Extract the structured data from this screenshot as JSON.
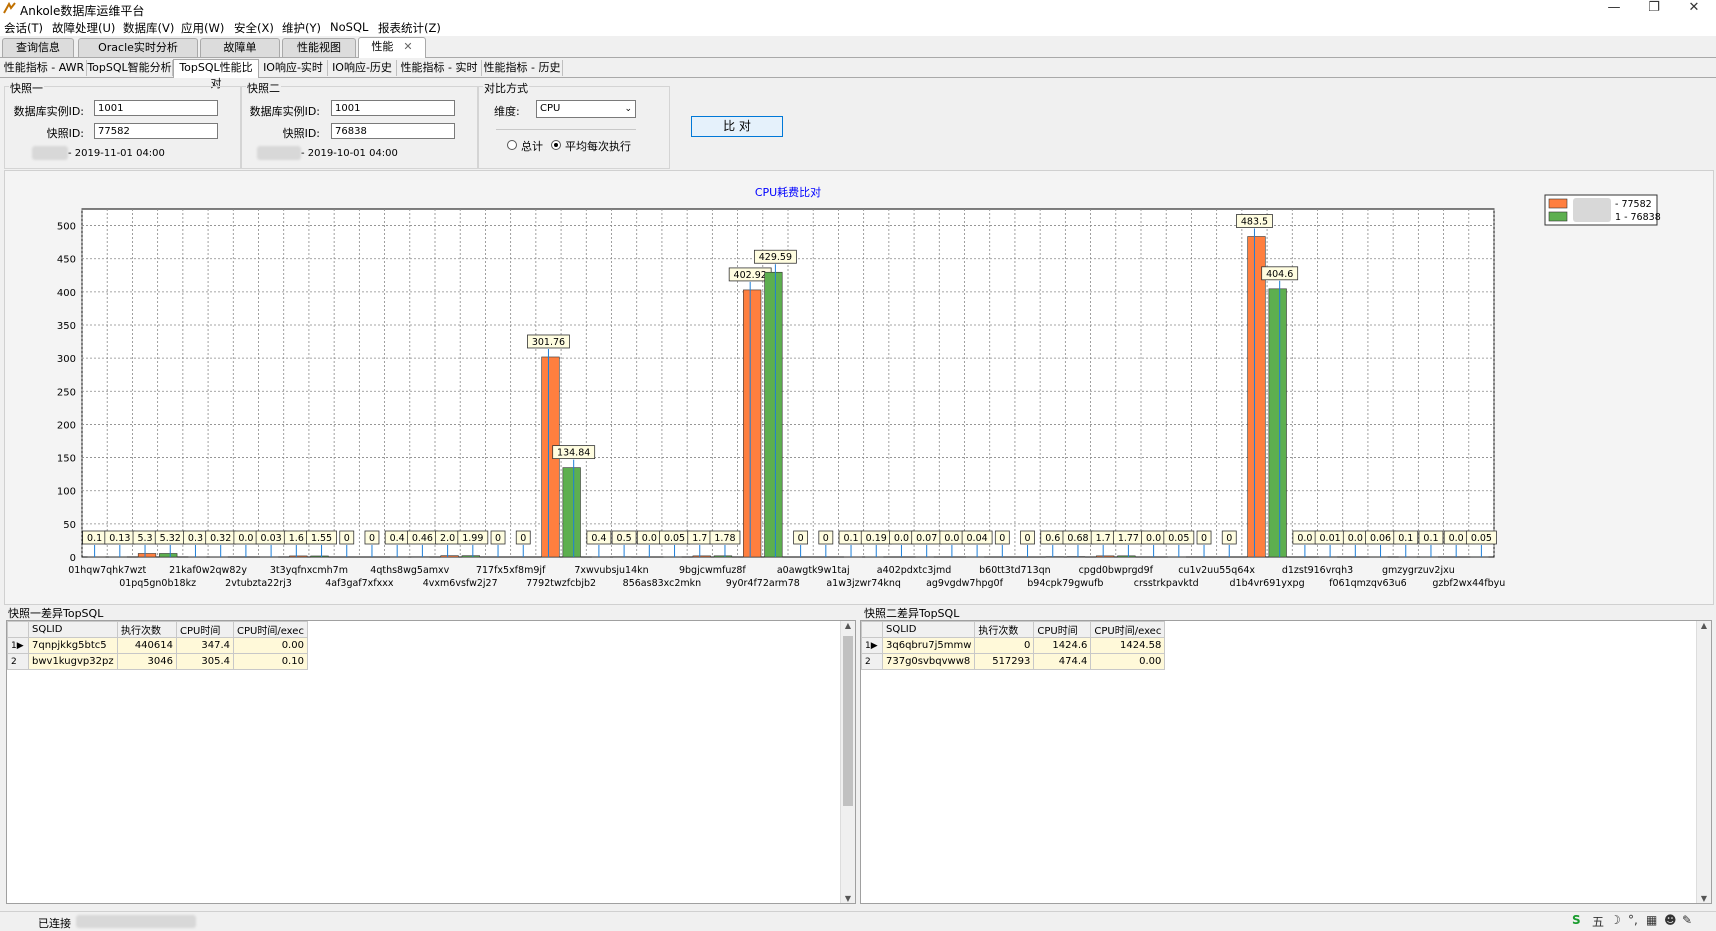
{
  "window": {
    "title": "Ankole数据库运维平台",
    "min": "—",
    "max": "❐",
    "close": "✕"
  },
  "menu": [
    "会话(T)",
    "故障处理(U)",
    "数据库(V)",
    "应用(W)",
    "安全(X)",
    "维护(Y)",
    "NoSQL",
    "报表统计(Z)"
  ],
  "main_tabs": [
    "查询信息",
    "Oracle实时分析",
    "故障单",
    "性能视图",
    "性能"
  ],
  "sub_tabs": [
    "性能指标 - AWR",
    "TopSQL智能分析",
    "TopSQL性能比对",
    "IO响应-实时",
    "IO响应-历史",
    "性能指标 - 实时",
    "性能指标 - 历史"
  ],
  "snap1": {
    "group": "快照一",
    "db_label": "数据库实例ID:",
    "db_id": "1001",
    "snap_label": "快照ID:",
    "snap_id": "77582",
    "time": "- 2019-11-01 04:00"
  },
  "snap2": {
    "group": "快照二",
    "db_label": "数据库实例ID:",
    "db_id": "1001",
    "snap_label": "快照ID:",
    "snap_id": "76838",
    "time": "- 2019-10-01 04:00"
  },
  "compare": {
    "group": "对比方式",
    "dim_label": "维度:",
    "dim_value": "CPU",
    "radio_total": "总计",
    "radio_avg": "平均每次执行",
    "button": "比  对"
  },
  "chart_data": {
    "type": "bar",
    "title": "CPU耗费比对",
    "ylim": [
      0,
      525
    ],
    "yticks": [
      0,
      50,
      100,
      150,
      200,
      250,
      300,
      350,
      400,
      450,
      500
    ],
    "grid": true,
    "legend_position": "top-right",
    "categories": [
      "01hqw7qhk7wzt",
      "01pq5gn0b18kz",
      "21kaf0w2qw82y",
      "2vtubzta22rj3",
      "3t3yqfnxcmh7m",
      "4af3gaf7xfxxx",
      "4qths8wg5amxv",
      "4vxm6vsfw2j27",
      "717fx5xf8m9jf",
      "7792twzfcbjb2",
      "7xwvubsju14kn",
      "856as83xc2mkn",
      "9bgjcwmfuz8f",
      "9y0r4f72arm78",
      "a0awgtk9w1taj",
      "a1w3jzwr74knq",
      "a402pdxtc3jmd",
      "ag9vgdw7hpg0f",
      "b60tt3td713qn",
      "b94cpk79gwufb",
      "cpgd0bwprgd9f",
      "crsstrkpavktd",
      "cu1v2uu55q64x",
      "d1b4vr691yxpg",
      "d1zst916vrqh3",
      "f061qmzqv63u6",
      "gmzygrzuv2jxu",
      "gzbf2wx44fbyu"
    ],
    "series": [
      {
        "name": "- 77582",
        "color": "#ff7f3f",
        "values": [
          0.1,
          0.13,
          5.3,
          5.32,
          0.3,
          0.32,
          0.0,
          0.03,
          1.6,
          1.55,
          0,
          0,
          0.4,
          0.46,
          2.0,
          1.99,
          0,
          0,
          301.76,
          134.84,
          0.4,
          0.5,
          0.0,
          0.05,
          1.7,
          1.78,
          402.92,
          429.59
        ]
      },
      {
        "name": "1 - 76838",
        "color": "#5daf4f",
        "values": [
          0,
          0,
          0.1,
          0.19,
          0.0,
          0.07,
          0.0,
          0.04,
          0,
          0,
          0.6,
          0.68,
          1.7,
          1.77,
          0.0,
          0.05,
          0,
          0,
          483.5,
          404.6,
          0.0,
          0.01,
          0.0,
          0.06,
          0.1,
          0.1,
          0.0,
          0.05
        ]
      }
    ],
    "label_texts": [
      "0.1",
      "0.13",
      "5.3",
      "5.32",
      "0.3",
      "0.32",
      "0.0",
      "0.03",
      "1.6",
      "1.55",
      "0",
      "0",
      "0.4",
      "0.46",
      "2.0",
      "1.99",
      "0",
      "0",
      "301.76",
      "134.84",
      "0.4",
      "0.5",
      "0.0",
      "0.05",
      "1.7",
      "1.78",
      "402.92",
      "429.59",
      "0",
      "0",
      "0.1",
      "0.19",
      "0.0",
      "0.07",
      "0.0",
      "0.04",
      "0",
      "0",
      "0.6",
      "0.68",
      "1.7",
      "1.77",
      "0.0",
      "0.05",
      "0",
      "0",
      "483.5",
      "404.6",
      "0.0",
      "0.01",
      "0.0",
      "0.06",
      "0.1",
      "0.1",
      "0.0",
      "0.05"
    ]
  },
  "diff1": {
    "label": "快照一差异TopSQL",
    "columns": [
      "SQLID",
      "执行次数",
      "CPU时间",
      "CPU时间/exec"
    ],
    "rows": [
      {
        "n": "1",
        "sqlid": "7qnpjkkg5btc5",
        "exec": "440614",
        "cpu": "347.4",
        "per": "0.00"
      },
      {
        "n": "2",
        "sqlid": "bwv1kugvp32pz",
        "exec": "3046",
        "cpu": "305.4",
        "per": "0.10"
      }
    ]
  },
  "diff2": {
    "label": "快照二差异TopSQL",
    "columns": [
      "SQLID",
      "执行次数",
      "CPU时间",
      "CPU时间/exec"
    ],
    "rows": [
      {
        "n": "1",
        "sqlid": "3q6qbru7j5mmw",
        "exec": "0",
        "cpu": "1424.6",
        "per": "1424.58"
      },
      {
        "n": "2",
        "sqlid": "737g0svbqvww8",
        "exec": "517293",
        "cpu": "474.4",
        "per": "0.00"
      }
    ]
  },
  "status": {
    "text": "已连接",
    "tray": [
      "S",
      "五",
      "☽",
      "°,",
      "▦",
      "☻",
      "✎"
    ]
  }
}
